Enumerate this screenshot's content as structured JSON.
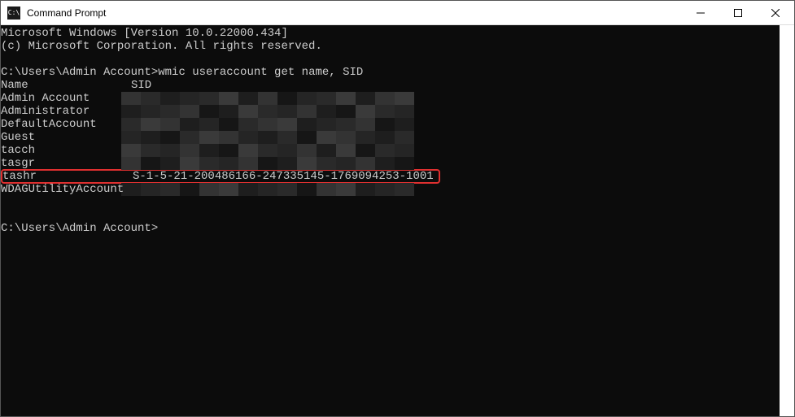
{
  "window": {
    "title": "Command Prompt"
  },
  "terminal": {
    "header1": "Microsoft Windows [Version 10.0.22000.434]",
    "header2": "(c) Microsoft Corporation. All rights reserved.",
    "prompt1_path": "C:\\Users\\Admin Account>",
    "command": "wmic useraccount get name, SID",
    "col_name": "Name",
    "col_sid": "SID",
    "accounts": [
      {
        "name": "Admin Account",
        "sid_hidden": true
      },
      {
        "name": "Administrator",
        "sid_hidden": true
      },
      {
        "name": "DefaultAccount",
        "sid_hidden": true
      },
      {
        "name": "Guest",
        "sid_hidden": true
      },
      {
        "name": "tacch",
        "sid_hidden": true
      },
      {
        "name": "tasgr",
        "sid_hidden": true
      },
      {
        "name": "tashr",
        "sid": "S-1-5-21-200486166-247335145-1769094253-1001",
        "highlighted": true
      },
      {
        "name": "WDAGUtilityAccount",
        "sid_hidden": true
      }
    ],
    "prompt2_path": "C:\\Users\\Admin Account>"
  }
}
